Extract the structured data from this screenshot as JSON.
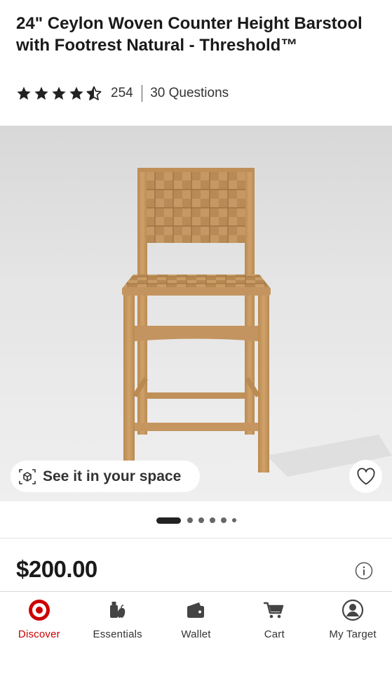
{
  "product": {
    "title": "24\" Ceylon Woven Counter Height Barstool with Footrest Natural - Threshold™",
    "rating": 4.5,
    "rating_max": 5,
    "review_count": "254",
    "questions": "30 Questions",
    "price": "$200.00"
  },
  "gallery": {
    "ar_button_label": "See it in your space",
    "image_count": 6,
    "current_image": 1
  },
  "tabbar": {
    "items": [
      {
        "label": "Discover",
        "icon": "target-bullseye-icon",
        "active": true
      },
      {
        "label": "Essentials",
        "icon": "essentials-icon",
        "active": false
      },
      {
        "label": "Wallet",
        "icon": "wallet-icon",
        "active": false
      },
      {
        "label": "Cart",
        "icon": "cart-icon",
        "active": false
      },
      {
        "label": "My Target",
        "icon": "account-icon",
        "active": false
      }
    ]
  },
  "colors": {
    "brand_red": "#cc0000",
    "text_dark": "#1a1a1a",
    "star": "#222222",
    "chair_wood": "#c9995e"
  }
}
